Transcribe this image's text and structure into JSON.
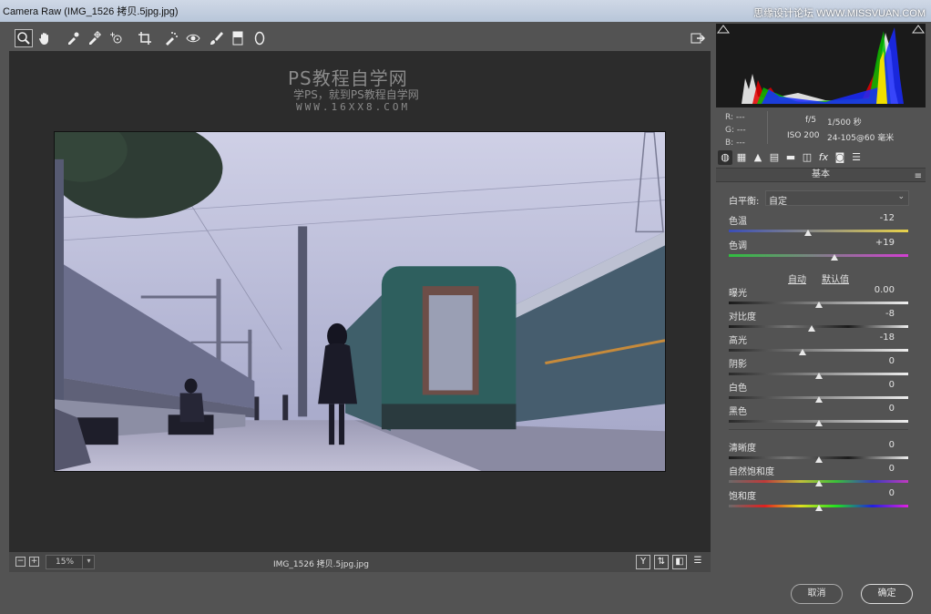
{
  "window": {
    "title": "Camera Raw (IMG_1526 拷贝.5jpg.jpg)",
    "watermark": "思缘设计论坛 WWW.MISSVUAN.COM"
  },
  "toolbar": {
    "tools": [
      "zoom-icon",
      "hand-icon",
      "white-balance-icon",
      "color-sampler-icon",
      "targeted-adjustment-icon",
      "crop-icon",
      "spot-removal-icon",
      "red-eye-icon",
      "adjustment-brush-icon",
      "graduated-filter-icon",
      "radial-filter-icon"
    ],
    "open_preferences": "preferences-icon"
  },
  "preview": {
    "watermark_title": "PS教程自学网",
    "watermark_sub": "学PS，就到PS教程自学网",
    "watermark_url": "WWW.16XX8.COM"
  },
  "status": {
    "zoom": "15%",
    "filename": "IMG_1526 拷贝.5jpg.jpg",
    "buttons": [
      "Y",
      "⇅",
      "◧",
      "☰"
    ]
  },
  "histogram": {
    "r": "R: ---",
    "g": "G: ---",
    "b": "B: ---",
    "aperture": "f/5",
    "shutter": "1/500 秒",
    "iso": "ISO 200",
    "lens": "24-105@60 毫米"
  },
  "panel": {
    "title": "基本",
    "menu": "≡",
    "wb_label": "白平衡:",
    "wb_value": "自定",
    "auto_link": "自动",
    "default_link": "默认值",
    "sliders": [
      {
        "label": "色温",
        "value": "-12",
        "pos": 0.44
      },
      {
        "label": "色调",
        "value": "+19",
        "pos": 0.59
      },
      {
        "label": "曝光",
        "value": "0.00",
        "pos": 0.5
      },
      {
        "label": "对比度",
        "value": "-8",
        "pos": 0.46
      },
      {
        "label": "高光",
        "value": "-18",
        "pos": 0.41
      },
      {
        "label": "阴影",
        "value": "0",
        "pos": 0.5
      },
      {
        "label": "白色",
        "value": "0",
        "pos": 0.5
      },
      {
        "label": "黑色",
        "value": "0",
        "pos": 0.5
      },
      {
        "label": "清晰度",
        "value": "0",
        "pos": 0.5
      },
      {
        "label": "自然饱和度",
        "value": "0",
        "pos": 0.5
      },
      {
        "label": "饱和度",
        "value": "0",
        "pos": 0.5
      }
    ]
  },
  "footer": {
    "cancel": "取消",
    "ok": "确定"
  }
}
